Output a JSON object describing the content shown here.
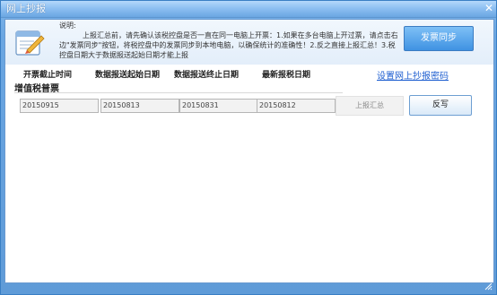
{
  "window": {
    "title": "网上抄报",
    "close_label": "✕"
  },
  "info": {
    "heading": "说明:",
    "text": "上报汇总前，请先确认该税控盘是否一直在同一电脑上开票：1.如果在多台电脑上开过票，请点击右边\"发票同步\"按钮，将税控盘中的发票同步到本地电脑，以确保统计的准确性！2.反之直接上报汇总！3.税控盘日期大于数据报送起始日期才能上报",
    "sync_button_label": "发票同步",
    "icon": "notepad-pencil-icon"
  },
  "headers": {
    "deadline": "开票截止时间",
    "start_date": "数据报送起始日期",
    "end_date": "数据报送终止日期",
    "latest": "最新报税日期"
  },
  "set_password_link": "设置网上抄报密码",
  "section": {
    "title": "增值税普票",
    "deadline_value": "20150915",
    "start_value": "20150813",
    "end_value": "20150831",
    "latest_value": "20150812",
    "summary_button_label": "上报汇总",
    "writeback_button_label": "反写"
  },
  "colors": {
    "window_frame": "#6aa6e2",
    "sync_button": "#3f92e2",
    "link": "#1f5fd0"
  }
}
